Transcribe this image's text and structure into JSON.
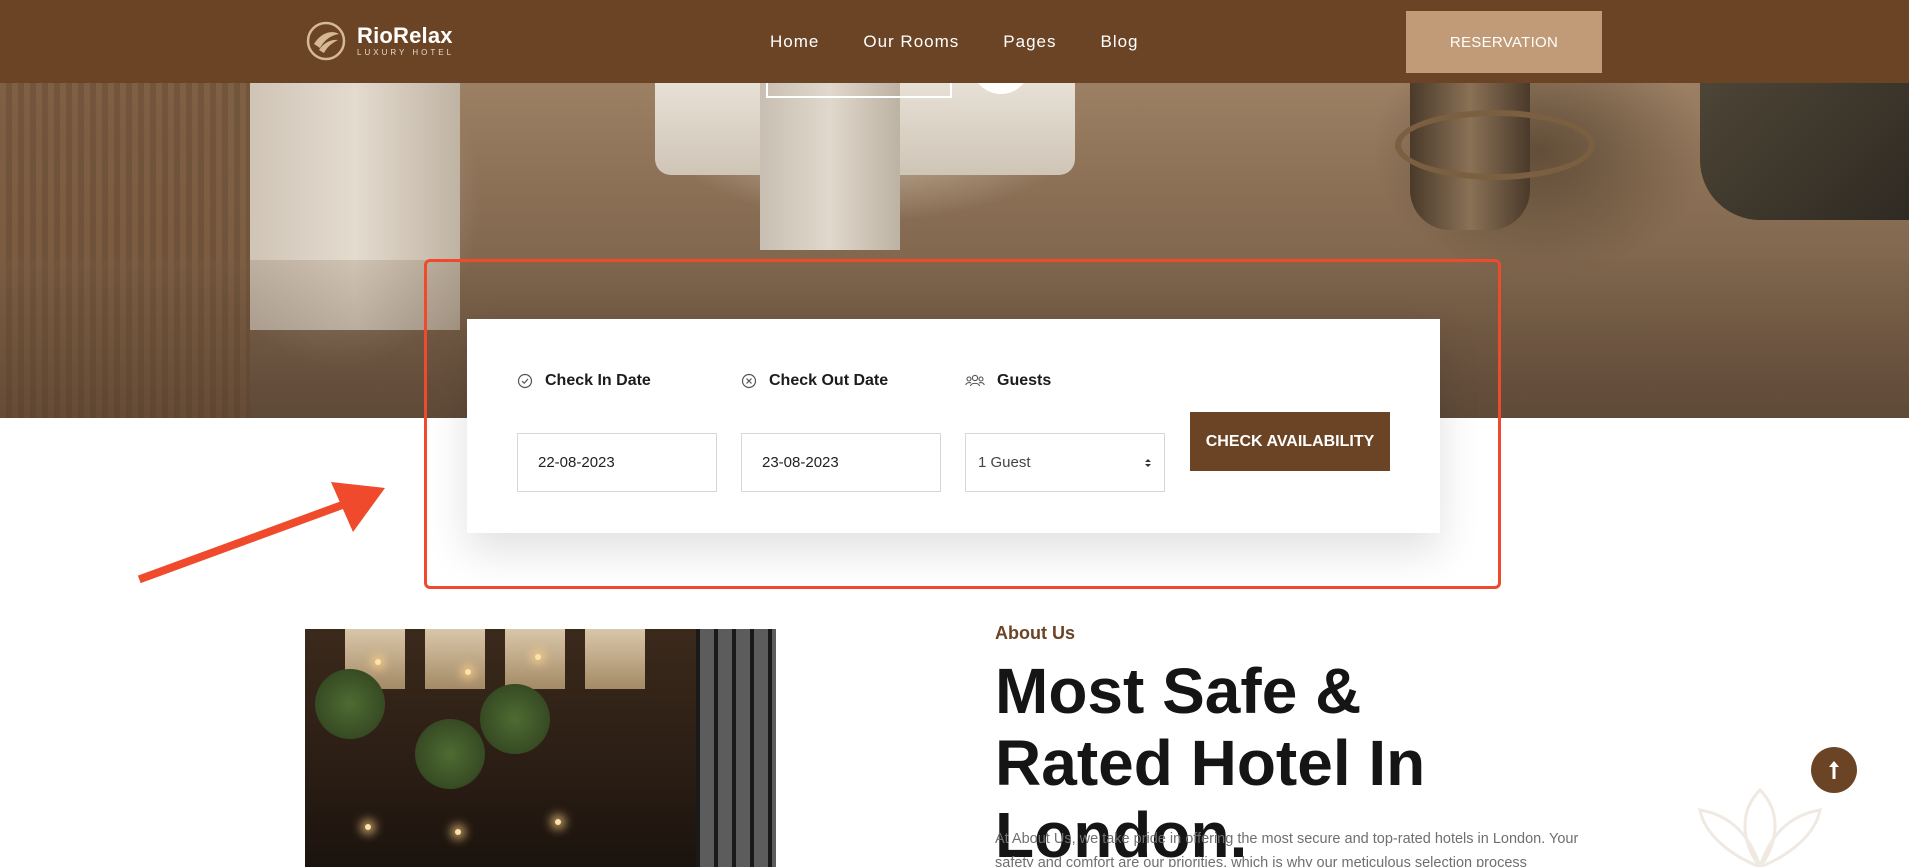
{
  "brand": {
    "name": "RioRelax",
    "tagline": "LUXURY HOTEL"
  },
  "nav": {
    "items": [
      "Home",
      "Our Rooms",
      "Pages",
      "Blog"
    ]
  },
  "header": {
    "reservation_label": "RESERVATION"
  },
  "booking": {
    "checkin_label": "Check In Date",
    "checkin_value": "22-08-2023",
    "checkout_label": "Check Out Date",
    "checkout_value": "23-08-2023",
    "guests_label": "Guests",
    "guests_value": "1 Guest",
    "submit_label": "CHECK AVAILABILITY"
  },
  "about": {
    "tag": "About Us",
    "title": "Most Safe & Rated Hotel In London.",
    "text": "At About Us, we take pride in offering the most secure and top-rated hotels in London. Your safety and comfort are our priorities, which is why our meticulous selection process"
  },
  "colors": {
    "brand_brown": "#6b4426",
    "reservation_tan": "#c19b78",
    "annotation_red": "#ef4a2c"
  },
  "icons": {
    "checkin": "check-circle-icon",
    "checkout": "x-circle-icon",
    "guests": "users-icon",
    "scroll_top": "arrow-up-icon"
  }
}
